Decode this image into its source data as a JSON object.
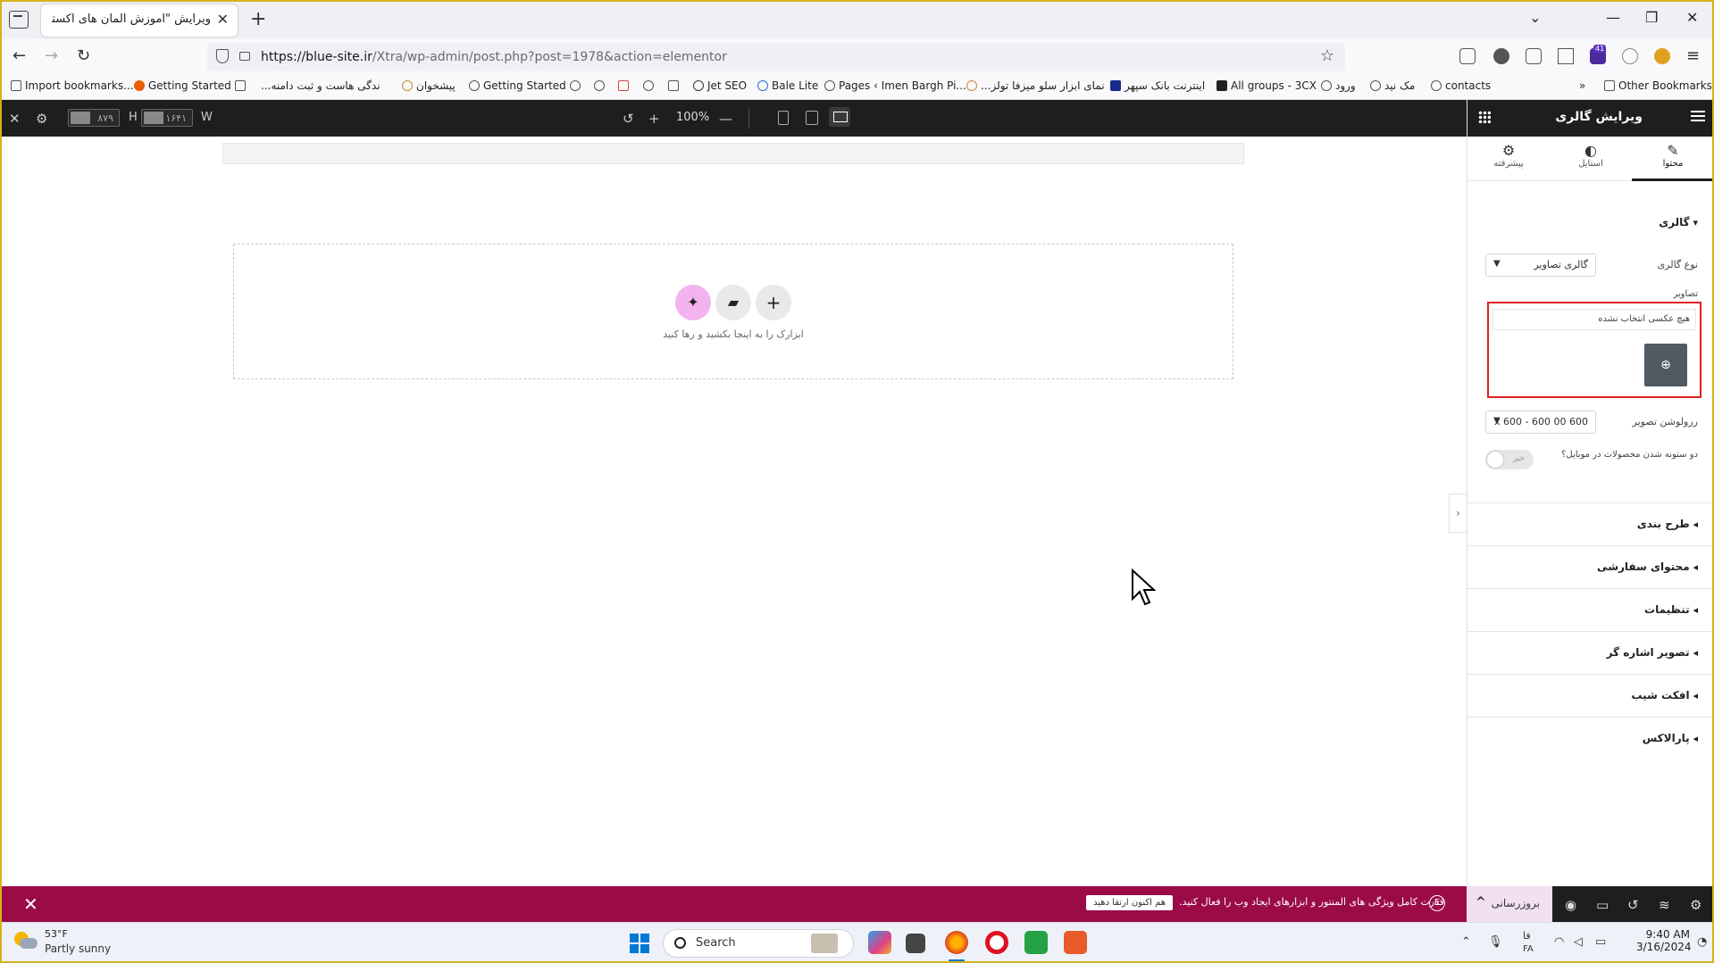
{
  "browser": {
    "tab_title": "ویرایش \"آموزش المان های اکسترا – ما",
    "url_host": "https://blue-site.ir",
    "url_path": "/Xtra/wp-admin/post.php?post=1978&action=elementor",
    "ext_badge": "41",
    "bookmarks": [
      "Import bookmarks...",
      "Getting Started",
      "...ندگی هاست و ثبت دامنه",
      "پیشخوان",
      "Getting Started",
      "Jet SEO",
      "Bale Lite",
      "Pages ‹ Imen Bargh Pi...",
      "...نمای ابزار سلو میزفا تولز",
      "اینترنت بانک سپهر",
      "All groups - 3CX",
      "ورود",
      "مک نید",
      "contacts"
    ],
    "other_bookmarks": "Other Bookmarks"
  },
  "editor_toolbar": {
    "height_value": "۸۷۹",
    "height_label": "H",
    "width_value": "۱۶۴۱",
    "width_label": "W",
    "zoom": "100%"
  },
  "canvas": {
    "drop_hint": "ابزارک را به اینجا بکشید و رها کنید"
  },
  "panel": {
    "title": "ویرایش گالری",
    "tabs": [
      {
        "label": "محتوا",
        "icon": "pencil-icon"
      },
      {
        "label": "استایل",
        "icon": "half-circle-icon"
      },
      {
        "label": "پیشرفته",
        "icon": "gear-icon"
      }
    ],
    "section_gallery": "گالری",
    "gallery_type_label": "نوع گالری",
    "gallery_type_value": "گالری تصاویر",
    "images_label": "تصاویر",
    "no_image_text": "هیچ عکسی انتخاب نشده",
    "resolution_label": "رزولوشن تصویر",
    "resolution_value": "600 x 600 - 600 00",
    "mobile_columns_label": "دو ستونه شدن محصولات در موبایل؟",
    "toggle_text": "خیر",
    "sections": [
      "طرح بندی",
      "محتوای سفارشی",
      "تنظیمات",
      "تصویر اشاره گر",
      "افکت شیب",
      "پارالاکس"
    ]
  },
  "bottom_bar": {
    "upgrade_button": "هم اکنون ارتقا دهید",
    "promo_text": "قدرت کامل ویژگی های المنتور و ابزارهای ایجاد وب را فعال کنید.",
    "publish_label": "بروزرسانی"
  },
  "taskbar": {
    "temperature": "53°F",
    "condition": "Partly sunny",
    "search_placeholder": "Search",
    "lang_top": "فا",
    "lang_bottom": "FA",
    "time": "9:40 AM",
    "date": "3/16/2024"
  }
}
